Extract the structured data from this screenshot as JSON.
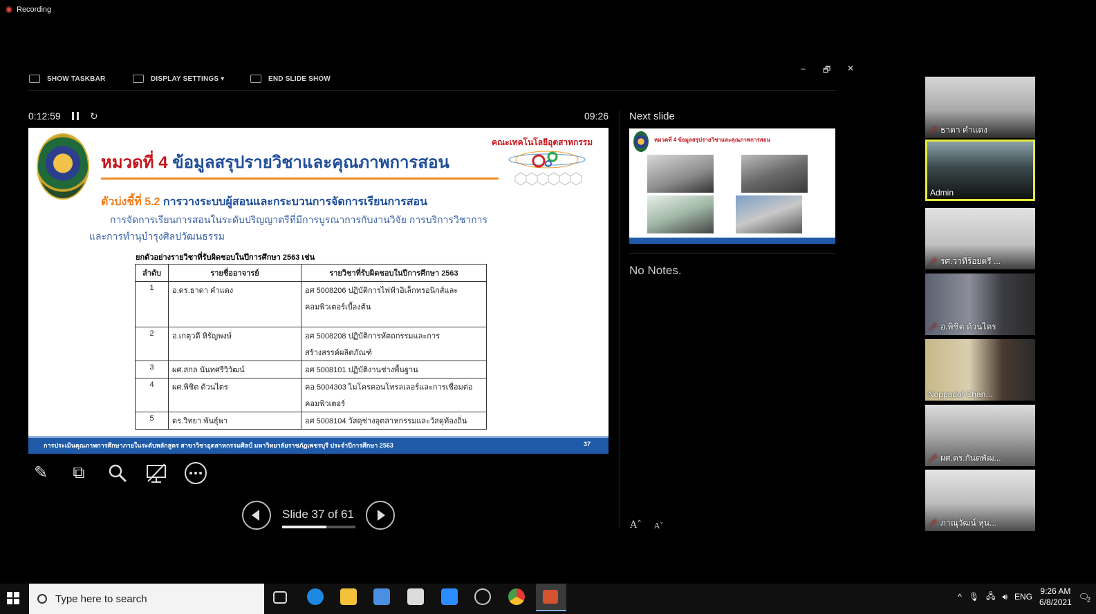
{
  "recording": {
    "label": "Recording"
  },
  "toolbar": {
    "show_taskbar": "SHOW TASKBAR",
    "display_settings": "DISPLAY SETTINGS ▾",
    "end_slide_show": "END SLIDE SHOW",
    "minimize": "–",
    "restore": "🗗",
    "close": "✕"
  },
  "timer": {
    "elapsed": "0:12:59",
    "clock": "09:26"
  },
  "slide": {
    "title_prefix": "หมวดที่ 4",
    "title_main": "ข้อมูลสรุปรายวิชาและคุณภาพการสอน",
    "faculty": "คณะเทคโนโลยีอุตสาหกรรม",
    "indicator_prefix": "ตัวบ่งชี้ที่ 5.2",
    "indicator_text": "การวางระบบผู้สอนและกระบวนการจัดการเรียนการสอน",
    "desc_line1": "การจัดการเรียนการสอนในระดับปริญญาตรีที่มีการบูรณาการกับงานวิจัย การบริการวิชาการ",
    "desc_line2": "และการทำนุบำรุงศิลปวัฒนธรรม",
    "table_caption": "ยกตัวอย่างรายวิชาที่รับผิดชอบในปีการศึกษา 2563 เช่น",
    "table_headers": [
      "ลำดับ",
      "รายชื่ออาจารย์",
      "รายวิชาที่รับผิดชอบในปีการศึกษา 2563"
    ],
    "table_rows": [
      [
        "1",
        "อ.ดร.ธาดา  คำแดง",
        "อศ 5008206 ปฏิบัติการไฟฟ้าอิเล็กทรอนิกส์และ",
        "คอมพิวเตอร์เบื้องต้น"
      ],
      [
        "2",
        "อ.เกตุวดี หิรัญพงษ์",
        "อศ 5008208     ปฏิบัติการหัตถกรรมและการ",
        "สร้างสรรค์ผลิตภัณฑ์"
      ],
      [
        "3",
        "ผศ.สกล นันทศรีวิวัฒน์",
        "อศ 5008101     ปฏิบัติงานช่างพื้นฐาน",
        ""
      ],
      [
        "4",
        "ผศ.พิชิต ด้วนไตร",
        "คอ 5004303     ไมโครคอนโทรลเลอร์และการเชื่อมต่อ",
        "คอมพิวเตอร์"
      ],
      [
        "5",
        "ดร.วิทยา พันธุ์พา",
        "อศ 5008104     วัสดุช่างอุตสาหกรรมและวัสดุท้องถิ่น",
        ""
      ]
    ],
    "footer": "การประเมินคุณภาพการศึกษาภายในระดับหลักสูตร สาขาวิชาอุตสาหกรรมศิลป์ มหาวิทยาลัยราชภัฏเพชรบุรี ประจำปีการศึกษา 2563",
    "page_number": "37"
  },
  "navigation": {
    "counter": "Slide 37 of 61",
    "progress_fraction": 0.607
  },
  "next_slide": {
    "label": "Next slide",
    "thumb_title": "หมวดที่ 4 ข้อมูลสรุปรายวิชาและคุณภาพการสอน"
  },
  "notes": {
    "text": "No Notes."
  },
  "font_controls": {
    "increase": "A˄",
    "decrease": "A˅"
  },
  "participants": [
    {
      "name": "ธาดา คำแดง",
      "muted": true,
      "active": false
    },
    {
      "name": "Admin",
      "muted": false,
      "active": true
    },
    {
      "name": "รศ.ว่าที่ร้อยตรี ...",
      "muted": true,
      "active": false
    },
    {
      "name": "อ.พิชิต ด้วนไตร",
      "muted": true,
      "active": false
    },
    {
      "name": "Noppadol Chan...",
      "muted": false,
      "active": false
    },
    {
      "name": "ผศ.ดร.กันตพัฒ...",
      "muted": true,
      "active": false
    },
    {
      "name": "ภาณุวัฒน์ หุ่น...",
      "muted": true,
      "active": false
    }
  ],
  "taskbar": {
    "search_placeholder": "Type here to search",
    "language": "ENG",
    "time": "9:26 AM",
    "date": "6/8/2021",
    "notification_count": "2"
  }
}
